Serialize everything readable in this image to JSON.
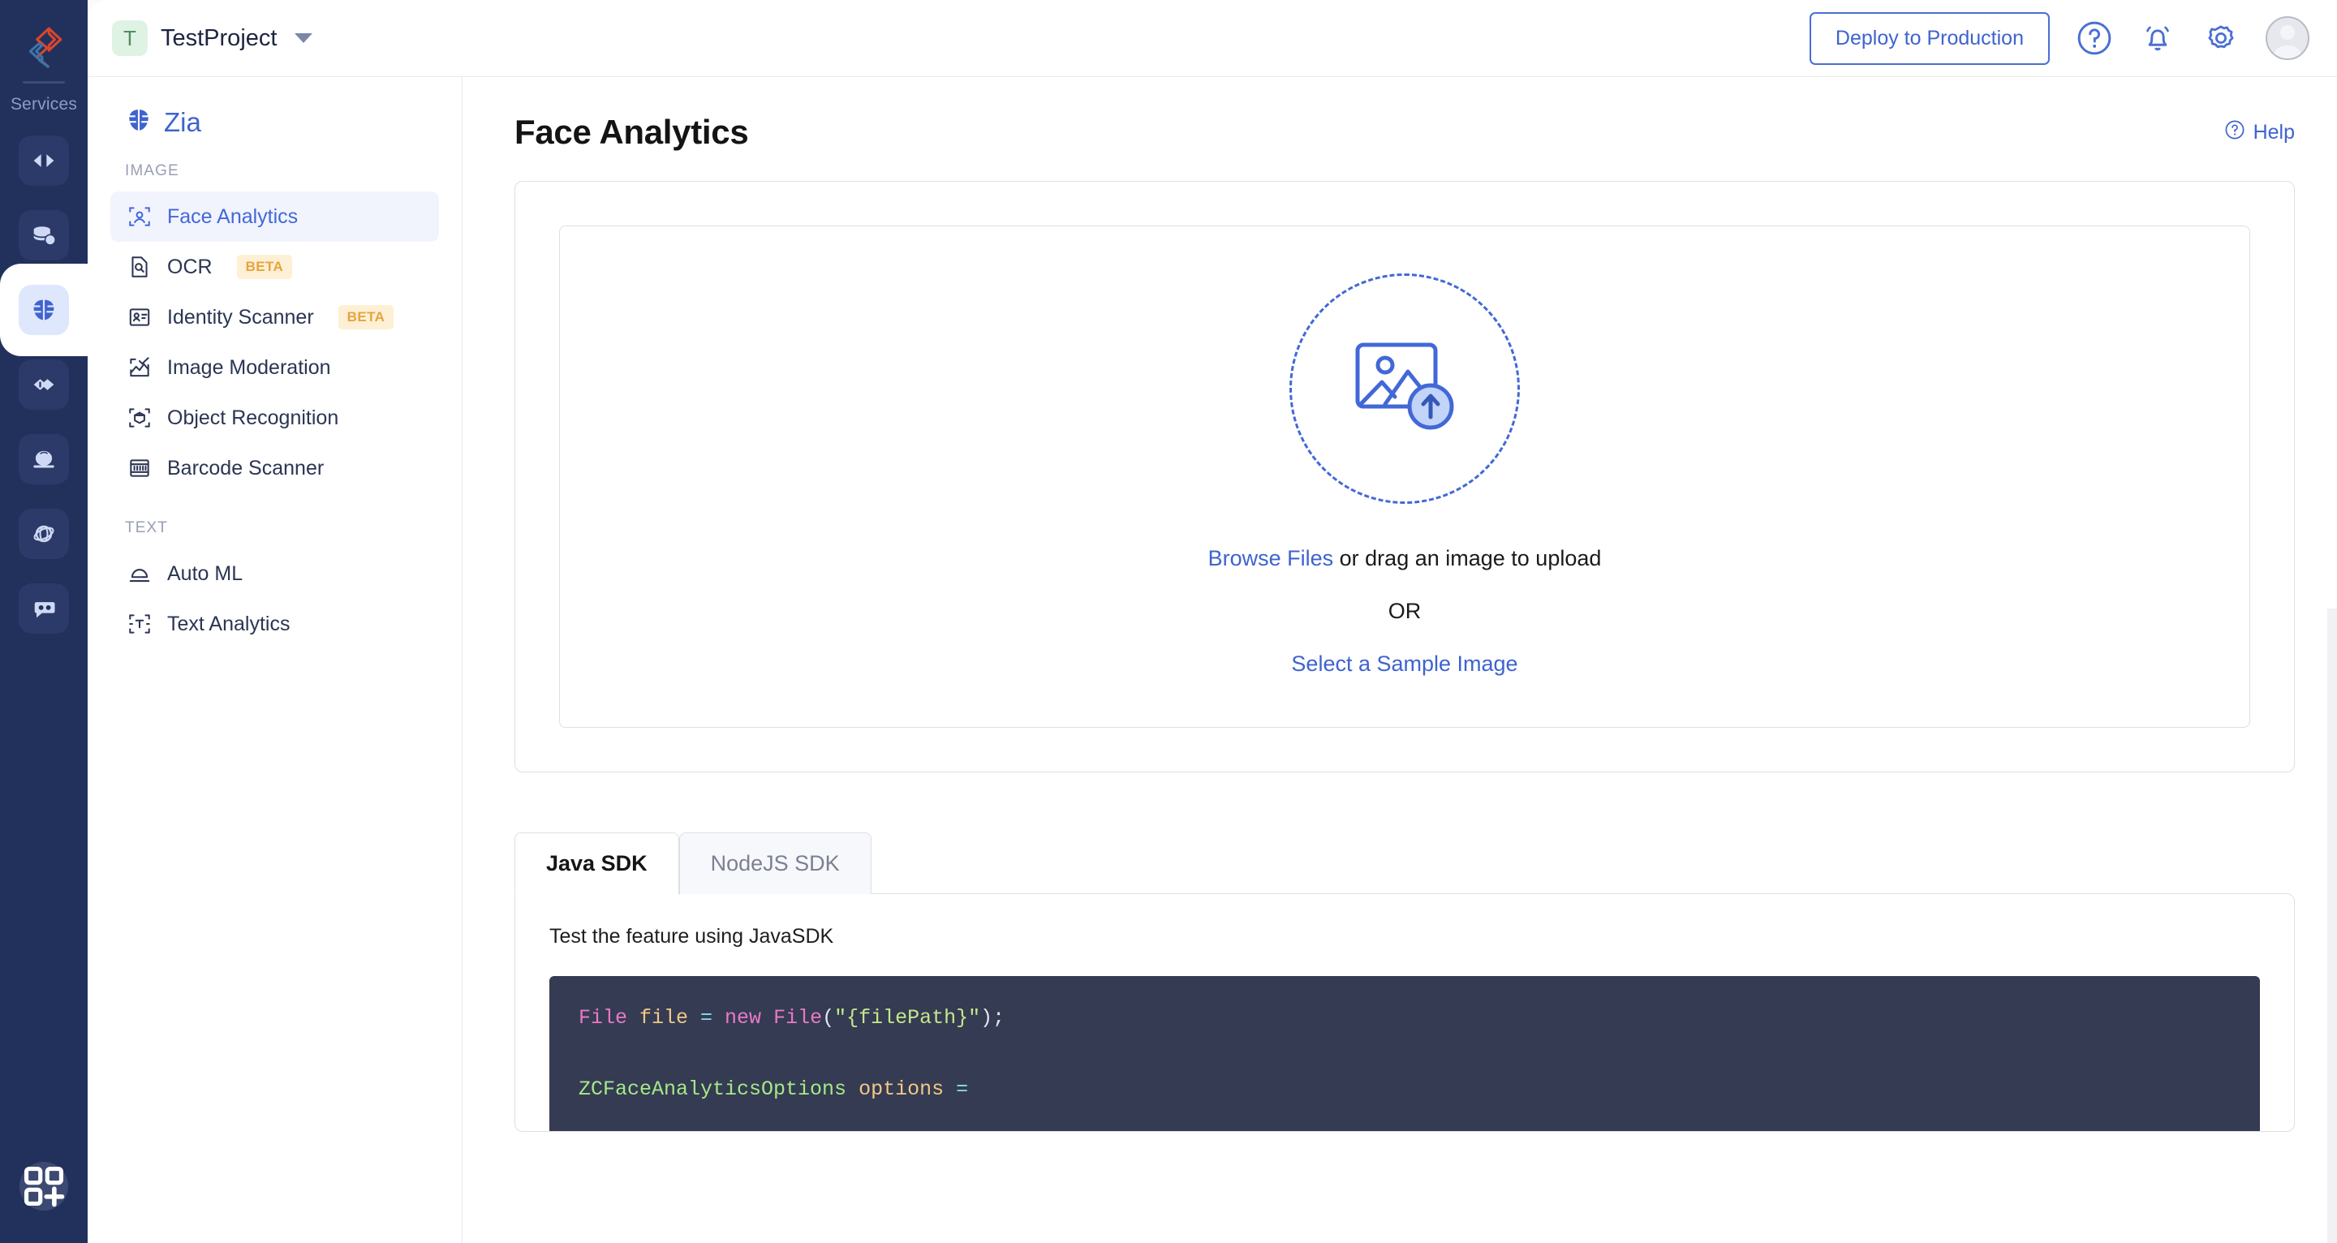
{
  "rail": {
    "logo_icon": "catalyst-logo-icon",
    "services_label": "Services",
    "items": [
      {
        "name": "code-icon",
        "active": false
      },
      {
        "name": "database-cloud-icon",
        "active": false
      },
      {
        "name": "zia-brain-icon",
        "active": true
      },
      {
        "name": "devops-infinity-icon",
        "active": false
      },
      {
        "name": "crystal-ball-icon",
        "active": false
      },
      {
        "name": "globe-network-icon",
        "active": false
      },
      {
        "name": "chat-bot-icon",
        "active": false
      }
    ],
    "add_button_icon": "grid-plus-icon"
  },
  "header": {
    "project_initial": "T",
    "project_name": "TestProject",
    "deploy_label": "Deploy to Production",
    "help_icon": "question-circle-icon",
    "bell_icon": "bell-icon",
    "settings_icon": "gear-icon",
    "avatar_icon": "user-avatar-icon"
  },
  "sidebar": {
    "brand": "Zia",
    "brand_icon": "zia-brain-icon",
    "groups": [
      {
        "label": "IMAGE",
        "items": [
          {
            "label": "Face Analytics",
            "icon": "face-scan-icon",
            "badge": "",
            "active": true
          },
          {
            "label": "OCR",
            "icon": "document-search-icon",
            "badge": "BETA",
            "active": false
          },
          {
            "label": "Identity Scanner",
            "icon": "id-card-icon",
            "badge": "BETA",
            "active": false
          },
          {
            "label": "Image Moderation",
            "icon": "image-check-icon",
            "badge": "",
            "active": false
          },
          {
            "label": "Object Recognition",
            "icon": "cube-scan-icon",
            "badge": "",
            "active": false
          },
          {
            "label": "Barcode Scanner",
            "icon": "barcode-icon",
            "badge": "",
            "active": false
          }
        ]
      },
      {
        "label": "TEXT",
        "items": [
          {
            "label": "Auto ML",
            "icon": "crystal-ball-icon",
            "badge": "",
            "active": false
          },
          {
            "label": "Text Analytics",
            "icon": "text-scan-icon",
            "badge": "",
            "active": false
          }
        ]
      }
    ]
  },
  "main": {
    "title": "Face Analytics",
    "help_label": "Help",
    "help_icon": "question-circle-icon",
    "upload": {
      "icon": "image-upload-icon",
      "browse_label": "Browse Files",
      "drag_text": " or drag an image to upload",
      "or_label": "OR",
      "sample_label": "Select a Sample Image"
    },
    "tabs": [
      {
        "label": "Java SDK",
        "active": true
      },
      {
        "label": "NodeJS SDK",
        "active": false
      }
    ],
    "panel_description": "Test the feature using JavaSDK",
    "code": {
      "line1": {
        "t1": "File",
        "t2": " file ",
        "t3": "= ",
        "t4": "new ",
        "t5": "File",
        "t6": "(",
        "t7": "\"{filePath}\"",
        "t8": ");"
      },
      "line2": {
        "t1": "ZCFaceAnalyticsOptions",
        "t2": " options ",
        "t3": "="
      }
    }
  },
  "colors": {
    "accent": "#3f63cf",
    "rail_bg": "#22305c",
    "badge_amber": "#e8a33d",
    "code_bg": "#353b52",
    "active_nav_bg": "#f1f4fd"
  }
}
